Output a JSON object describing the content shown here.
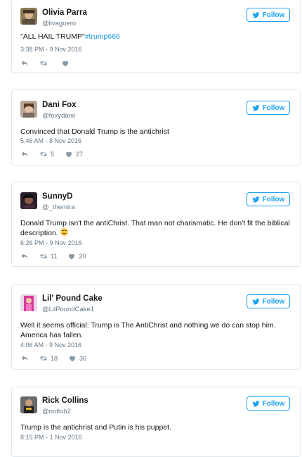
{
  "follow_label": "Follow",
  "icons": {
    "twitter": "twitter-bird-icon",
    "reply": "reply-icon",
    "retweet": "retweet-icon",
    "like": "heart-icon"
  },
  "colors": {
    "accent": "#1da1f2",
    "hashtag": "#1b95e0",
    "muted": "#657786",
    "border": "#e1e8ed"
  },
  "tweets": [
    {
      "name": "Olivia Parra",
      "handle": "@livaguero",
      "text": "\"ALL HAIL TRUMP\"",
      "hashtag": "#trump666",
      "time": "3:38 PM - 9 Nov 2016",
      "retweets": "",
      "likes": ""
    },
    {
      "name": "Dani Fox",
      "handle": "@foxydanii",
      "text": "Convinced that Donald Trump is the antichrist",
      "time": "5:46 AM - 8 Nov 2016",
      "retweets": "5",
      "likes": "27"
    },
    {
      "name": "SunnyD",
      "handle": "@_themira",
      "text": "Donald Trump isn't the antiChrist. That man not charismatic. He don't fit the biblical description.",
      "time": "6:26 PM - 9 Nov 2016",
      "retweets": "11",
      "likes": "20"
    },
    {
      "name": "Lil' Pound Cake",
      "handle": "@LilPoundCake1",
      "text": "Well it seems official: Trump is The AntiChrist and nothing we do can stop him. America has fallen.",
      "time": "4:06 AM - 9 Nov 2016",
      "retweets": "18",
      "likes": "36"
    },
    {
      "name": "Rick Collins",
      "handle": "@notlob2",
      "text": "Trump is the antichrist and Putin is his puppet.",
      "time": "8:15 PM - 1 Nov 2016",
      "retweets": "",
      "likes": ""
    }
  ]
}
